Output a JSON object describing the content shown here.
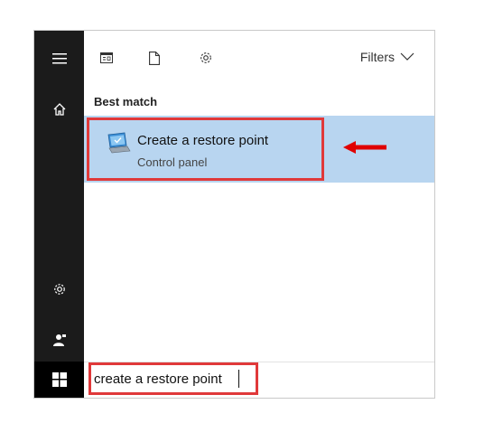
{
  "toolbar": {
    "filters_label": "Filters",
    "icons": [
      "apps-icon",
      "document-icon",
      "settings-icon",
      "chevron-down-icon"
    ]
  },
  "sidebar": {
    "icons": [
      "hamburger-menu-icon",
      "home-icon",
      "settings-icon",
      "user-icon",
      "windows-logo-icon"
    ]
  },
  "results": {
    "section_title": "Best match",
    "best_match": {
      "title": "Create a restore point",
      "subtitle": "Control panel",
      "icon": "restore-point-icon"
    }
  },
  "search": {
    "value": "create a restore point"
  },
  "colors": {
    "sidebar_bg": "#1b1b1b",
    "selected_row_bg": "#b8d5f0",
    "annotation_red": "#e0393a"
  }
}
